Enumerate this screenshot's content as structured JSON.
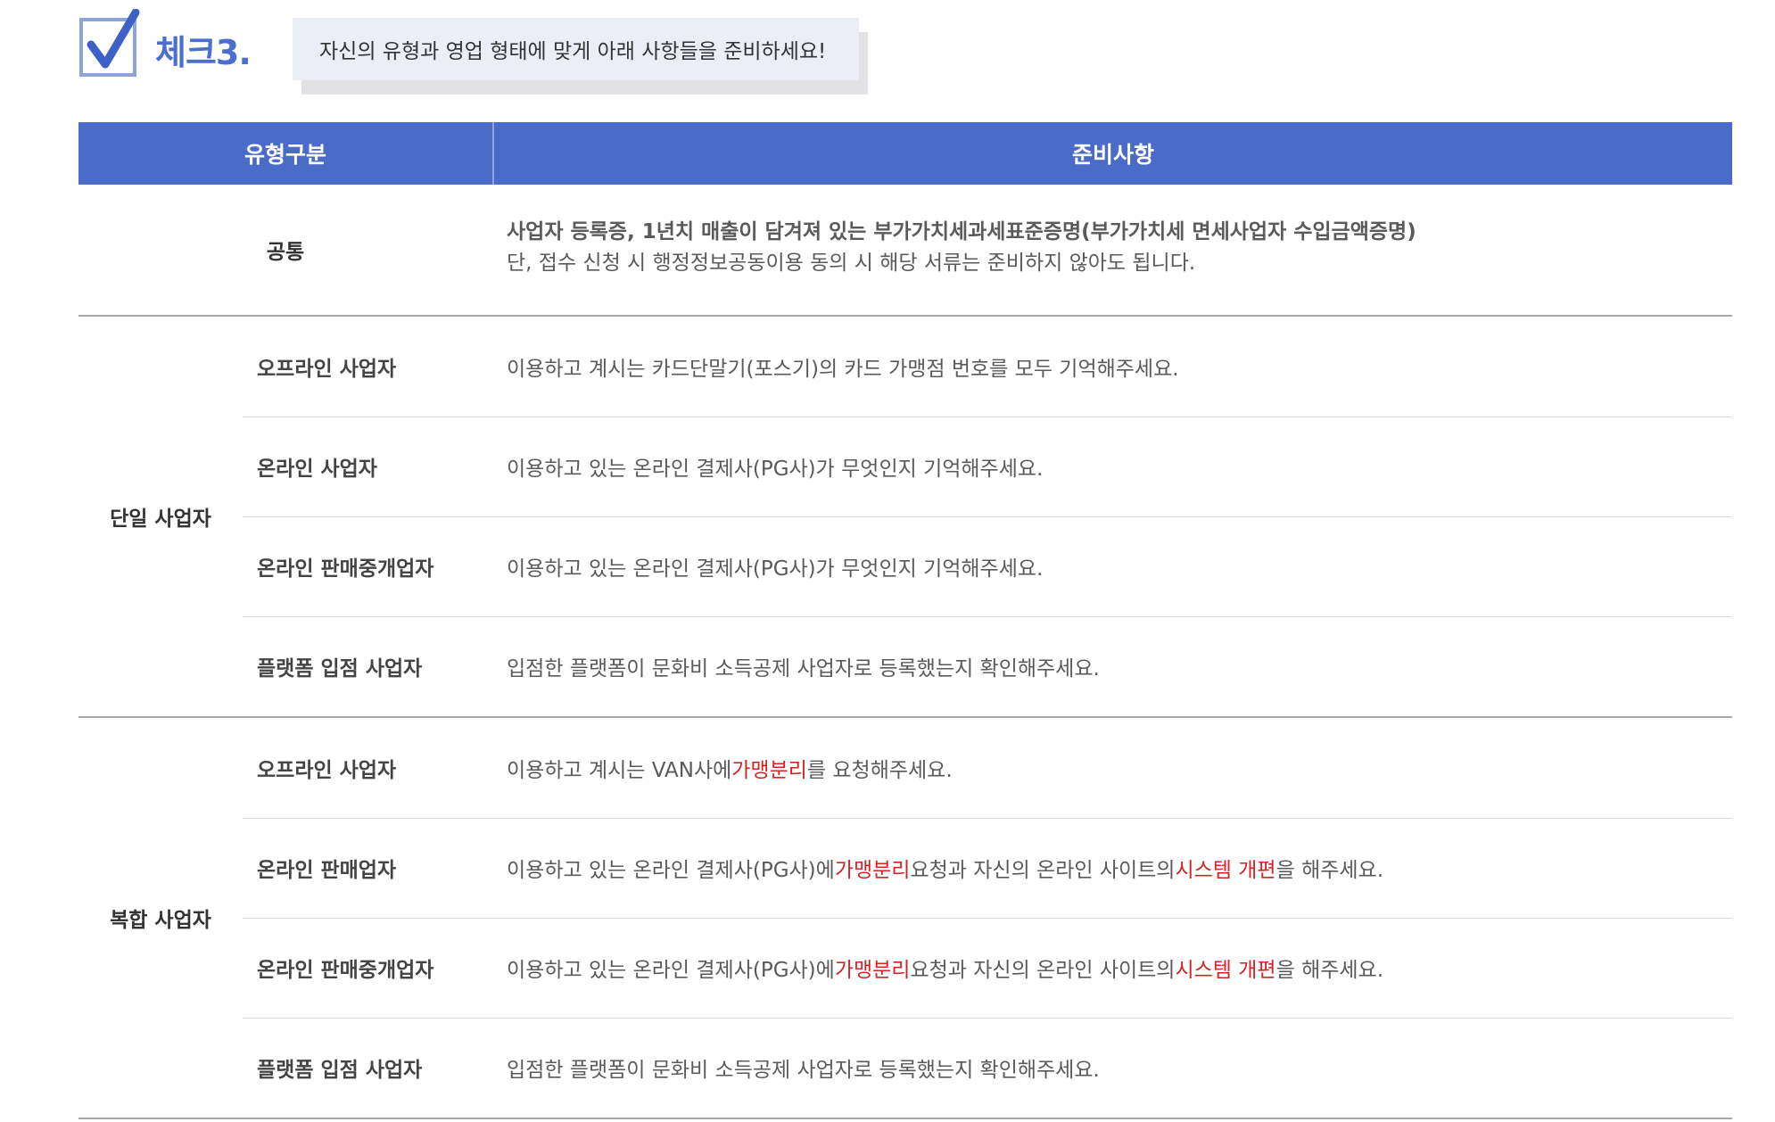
{
  "header": {
    "check_title": "체크3.",
    "callout_text": "자신의 유형과 영업 형태에 맞게 아래 사항들을 준비하세요!"
  },
  "table": {
    "col_type": "유형구분",
    "col_prep": "준비사항",
    "common": {
      "label": "공통",
      "line1": "사업자 등록증, 1년치 매출이 담겨져 있는 부가가치세과세표준증명(부가가치세 면세사업자 수입금액증명)",
      "line2": "단, 접수 신청 시 행정정보공동이용 동의 시 해당 서류는 준비하지 않아도 됩니다."
    },
    "single": {
      "label": "단일 사업자",
      "rows": [
        {
          "type": "오프라인 사업자",
          "text": "이용하고 계시는 카드단말기(포스기)의 카드 가맹점 번호를 모두 기억해주세요."
        },
        {
          "type": "온라인 사업자",
          "text": "이용하고 있는 온라인 결제사(PG사)가 무엇인지 기억해주세요."
        },
        {
          "type": "온라인 판매중개업자",
          "text": "이용하고 있는 온라인 결제사(PG사)가 무엇인지 기억해주세요."
        },
        {
          "type": "플랫폼 입점 사업자",
          "text": "입점한 플랫폼이 문화비 소득공제 사업자로 등록했는지 확인해주세요."
        }
      ]
    },
    "compound": {
      "label": "복합 사업자",
      "rows": [
        {
          "type": "오프라인 사업자",
          "t1": "이용하고 계시는 VAN사에 ",
          "h1": "가맹분리",
          "t2": "를 요청해주세요.",
          "h2": "",
          "t3": ""
        },
        {
          "type": "온라인 판매업자",
          "t1": "이용하고 있는 온라인 결제사(PG사)에 ",
          "h1": "가맹분리",
          "t2": " 요청과 자신의 온라인 사이트의 ",
          "h2": "시스템 개편",
          "t3": "을 해주세요."
        },
        {
          "type": "온라인 판매중개업자",
          "t1": "이용하고 있는 온라인 결제사(PG사)에 ",
          "h1": "가맹분리",
          "t2": " 요청과 자신의 온라인 사이트의 ",
          "h2": "시스템 개편",
          "t3": "을 해주세요."
        },
        {
          "type": "플랫폼 입점 사업자",
          "t1": "입점한 플랫폼이 문화비 소득공제 사업자로 등록했는지 확인해주세요.",
          "h1": "",
          "t2": "",
          "h2": "",
          "t3": ""
        }
      ]
    }
  },
  "colors": {
    "header_bg": "#4a6cc8",
    "title_blue": "#4a6fd1",
    "highlight_red": "#d42424"
  },
  "icons": {
    "checkbox": "checkbox-checked-icon"
  }
}
